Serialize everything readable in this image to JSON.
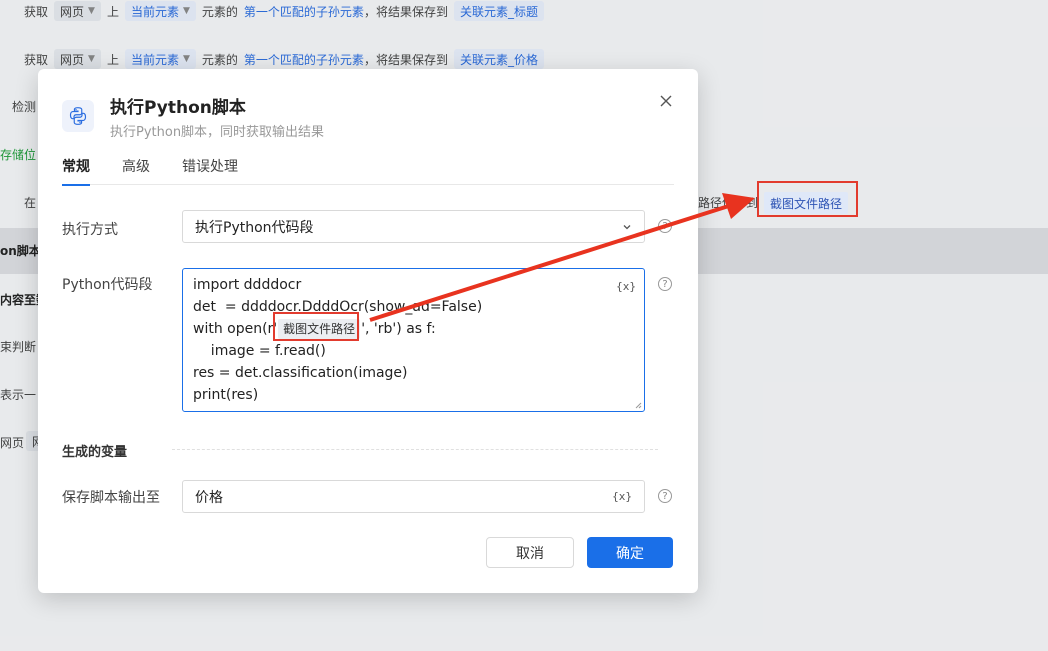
{
  "background": {
    "row1": {
      "t1": "获取",
      "c1": "网页",
      "t2": "上",
      "c2": "当前元素",
      "t3": "元素的",
      "l1": "第一个匹配的子孙元素",
      "t4": "，将结果保存到",
      "c3": "关联元素_标题"
    },
    "row2": {
      "t1": "获取",
      "c1": "网页",
      "t2": "上",
      "c2": "当前元素",
      "t3": "元素的",
      "l1": "第一个匹配的子孙元素",
      "t4": "，将结果保存到",
      "c3": "关联元素_价格"
    },
    "detect": "检测",
    "storage": "存储位",
    "at": "在",
    "save_path_text": "路径保存到",
    "highlight_chip": "截图文件路径",
    "band1": "on脚本",
    "band2": "内容至数",
    "judge": "束判断",
    "represent": "表示一",
    "webpage": "网页",
    "webpage_chip": "网"
  },
  "modal": {
    "title": "执行Python脚本",
    "subtitle": "执行Python脚本，同时获取输出结果",
    "tabs": [
      "常规",
      "高级",
      "错误处理"
    ],
    "exec_label": "执行方式",
    "exec_value": "执行Python代码段",
    "code_label": "Python代码段",
    "var_button": "{x}",
    "code_lines": {
      "l1": "import ddddocr",
      "l2": "det  = ddddocr.DdddOcr(show_ad=False)",
      "l3a": "with open(r'",
      "l3chip": "截图文件路径",
      "l3b": "', 'rb') as f:",
      "l4": "    image = f.read()",
      "l5": "res = det.classification(image)",
      "l6": "print(res)"
    },
    "section_generated": "生成的变量",
    "output_label": "保存脚本输出至",
    "output_value": "价格",
    "cancel": "取消",
    "ok": "确定"
  }
}
